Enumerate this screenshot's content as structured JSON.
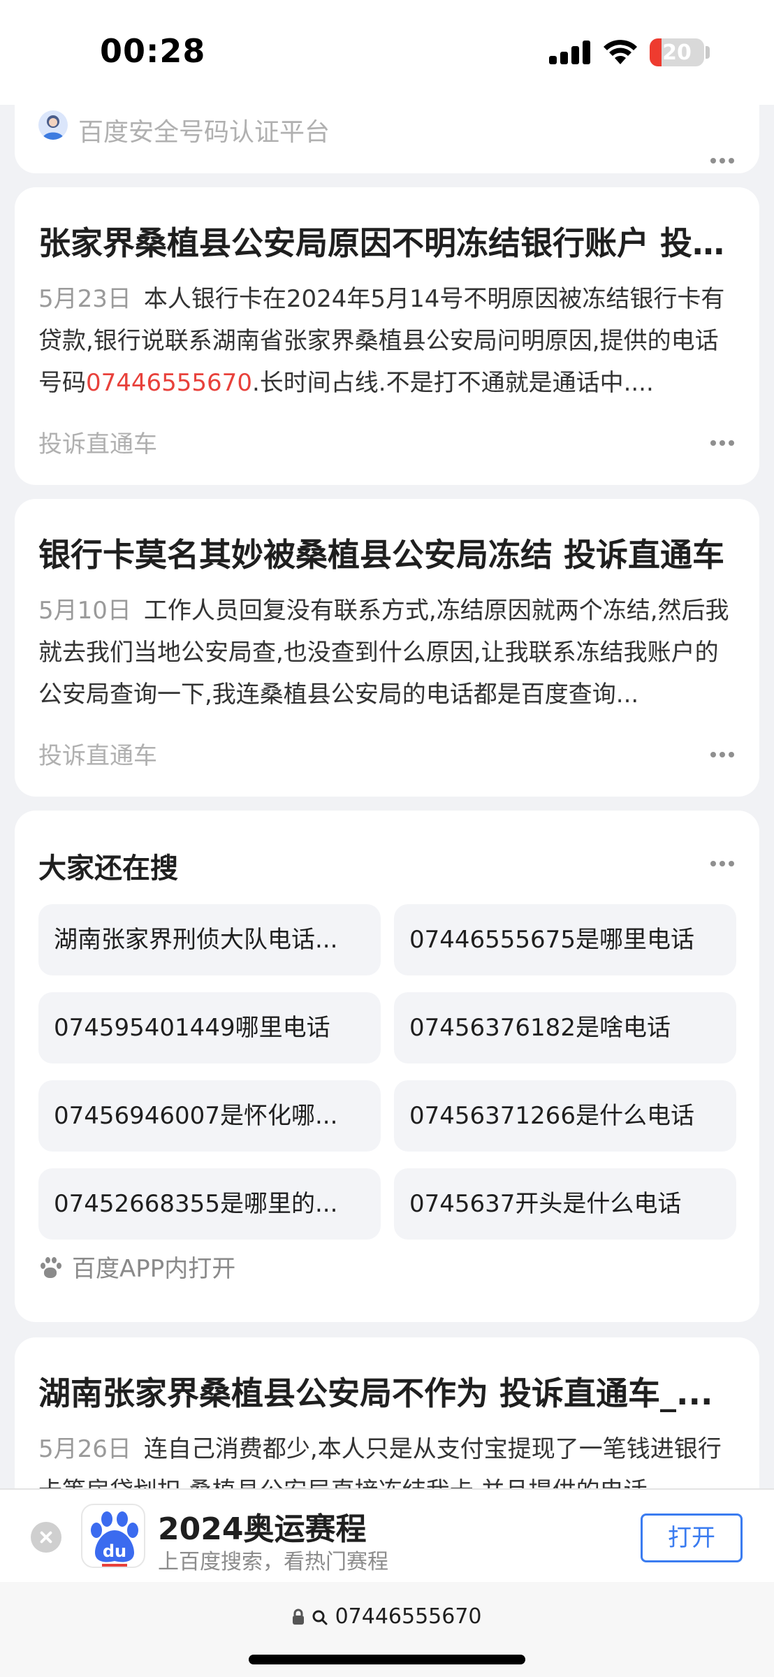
{
  "status_bar": {
    "time": "00:28",
    "battery": "20"
  },
  "top_card": {
    "source": "百度安全号码认证平台"
  },
  "results": [
    {
      "title": "张家界桑植县公安局原因不明冻结银行账户 投诉直通车",
      "date": "5月23日",
      "body_pre": "本人银行卡在2024年5月14号不明原因被冻结银行卡有贷款,银行说联系湖南省张家界桑植县公安局问明原因,提供的电话号码",
      "body_highlight": "07446555670",
      "body_post": ".长时间占线.不是打不通就是通话中....",
      "source": "投诉直通车"
    },
    {
      "title": "银行卡莫名其妙被桑植县公安局冻结 投诉直通车",
      "date": "5月10日",
      "body": "工作人员回复没有联系方式,冻结原因就两个冻结,然后我就去我们当地公安局查,也没查到什么原因,让我联系冻结我账户的公安局查询一下,我连桑植县公安局的电话都是百度查询...",
      "source": "投诉直通车"
    }
  ],
  "related_search": {
    "title": "大家还在搜",
    "items": [
      "湖南张家界刑侦大队电话...",
      "07446555675是哪里电话",
      "074595401449哪里电话",
      "07456376182是啥电话",
      "07456946007是怀化哪...",
      "07456371266是什么电话",
      "07452668355是哪里的...",
      "0745637开头是什么电话"
    ],
    "app_open": "百度APP内打开"
  },
  "last_result": {
    "title": "湖南张家界桑植县公安局不作为 投诉直通车_...",
    "date": "5月26日",
    "body": "连自己消费都少,本人只是从支付宝提现了一笔钱进银行卡等房贷划扣,桑植县公安局直接冻结我卡,并且提供的电话"
  },
  "banner": {
    "title": "2024奥运赛程",
    "subtitle": "上百度搜索，看热门赛程",
    "open": "打开"
  },
  "url_bar": {
    "query": "07446555670"
  },
  "colors": {
    "accent": "#3b7cf0",
    "highlight": "#e8413b",
    "battery_low": "#ee3b2f"
  }
}
